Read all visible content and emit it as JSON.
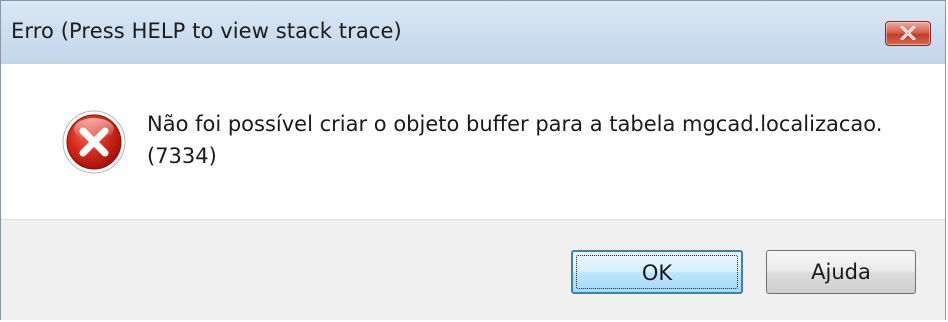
{
  "window": {
    "title": "Erro (Press HELP to view stack trace)",
    "close_icon": "close-icon"
  },
  "message": {
    "icon": "error-icon",
    "line1": "Não foi possível criar o objeto buffer para a tabela mgcad.localizacao.",
    "line2": "(7334)"
  },
  "buttons": {
    "ok_label": "OK",
    "help_label": "Ajuda"
  },
  "colors": {
    "titlebar": "#cfdff0",
    "close_button": "#c94a33",
    "error_icon": "#d42a1c",
    "default_button_border": "#3c7fb1"
  }
}
